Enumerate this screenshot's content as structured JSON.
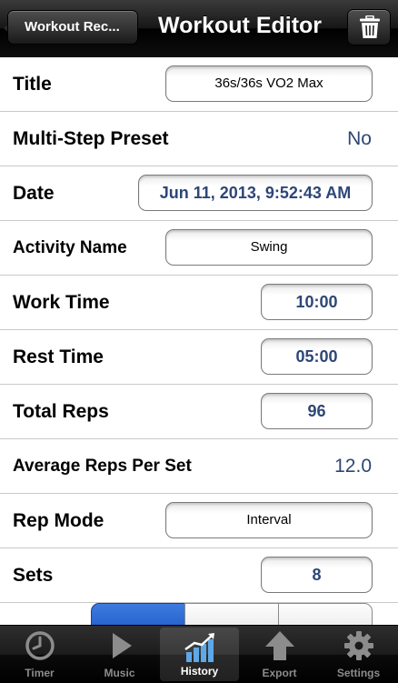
{
  "navbar": {
    "back_label": "Workout Rec...",
    "title": "Workout Editor"
  },
  "rows": {
    "title": {
      "label": "Title",
      "value": "36s/36s VO2 Max"
    },
    "multistep": {
      "label": "Multi-Step Preset",
      "value": "No"
    },
    "date": {
      "label": "Date",
      "value": "Jun 11, 2013, 9:52:43 AM"
    },
    "activity": {
      "label": "Activity Name",
      "value": "Swing"
    },
    "work_time": {
      "label": "Work Time",
      "value": "10:00"
    },
    "rest_time": {
      "label": "Rest Time",
      "value": "05:00"
    },
    "total_reps": {
      "label": "Total Reps",
      "value": "96"
    },
    "avg_reps": {
      "label": "Average Reps Per Set",
      "value": "12.0"
    },
    "rep_mode": {
      "label": "Rep Mode",
      "value": "Interval"
    },
    "sets": {
      "label": "Sets",
      "value": "8"
    }
  },
  "tabbar": {
    "tabs": [
      {
        "label": "Timer",
        "icon": "clock-icon"
      },
      {
        "label": "Music",
        "icon": "play-icon"
      },
      {
        "label": "History",
        "icon": "chart-icon",
        "active": true
      },
      {
        "label": "Export",
        "icon": "up-arrow-icon"
      },
      {
        "label": "Settings",
        "icon": "gear-icon"
      }
    ]
  },
  "colors": {
    "value_blue": "#2d4676",
    "segment_selected": "#1a56c6"
  }
}
